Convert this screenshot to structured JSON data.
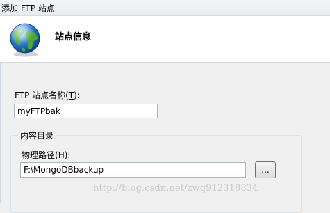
{
  "window": {
    "title": "添加 FTP 站点"
  },
  "banner": {
    "title": "站点信息",
    "icon": "globe-icon"
  },
  "site_name": {
    "label_prefix": "FTP 站点名称(",
    "label_accel": "T",
    "label_suffix": "):",
    "value": "myFTPbak"
  },
  "content_directory": {
    "legend": "内容目录",
    "path_label_prefix": "物理路径(",
    "path_label_accel": "H",
    "path_label_suffix": "):",
    "path_value": "F:\\MongoDBbackup",
    "browse_label": "..."
  },
  "watermark": "http://blog.csdn.net/zwq912318834"
}
